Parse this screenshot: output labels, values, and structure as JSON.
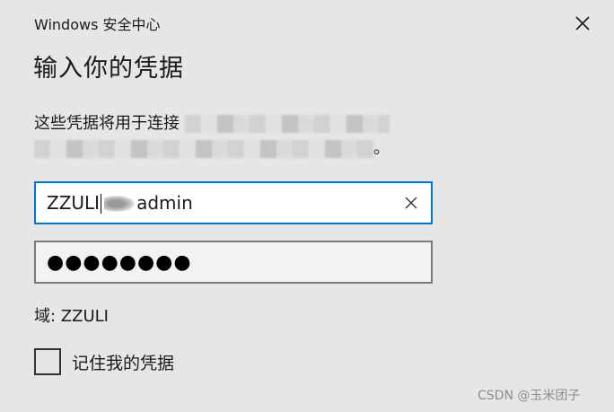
{
  "window": {
    "app_title": "Windows 安全中心",
    "close_icon": "close-icon"
  },
  "dialog": {
    "heading": "输入你的凭据",
    "description_start": "这些凭据将用于连接",
    "description_end": "。"
  },
  "username": {
    "value_prefix": "ZZULI",
    "value_suffix": "admin",
    "clear_icon": "clear-icon"
  },
  "password": {
    "value": "●●●●●●●●"
  },
  "domain": {
    "label": "域: ZZULI"
  },
  "remember": {
    "label": "记住我的凭据"
  },
  "watermark": {
    "text": "CSDN @玉米团子"
  },
  "colors": {
    "background": "#e6e6e6",
    "focus_border": "#0078d7",
    "input_border": "#7a7a7a"
  }
}
